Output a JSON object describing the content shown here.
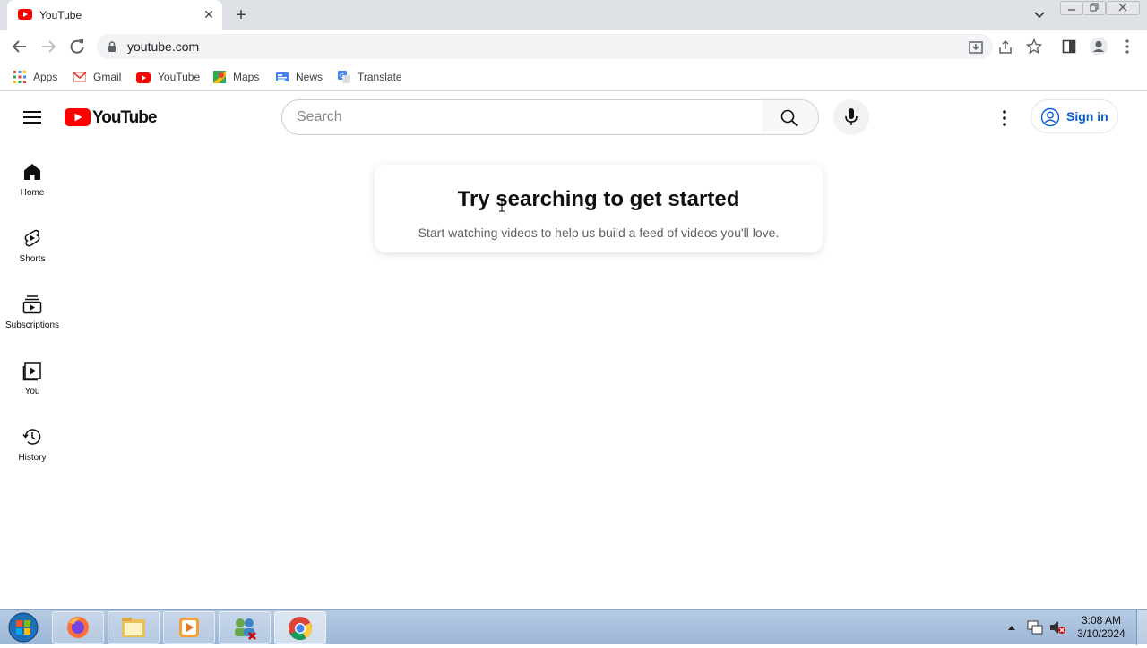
{
  "browser": {
    "tab_title": "YouTube",
    "new_tab_symbol": "+",
    "url": "youtube.com",
    "window_controls": [
      "minimize-icon",
      "restore-icon",
      "close-icon"
    ]
  },
  "bookmarks": [
    {
      "label": "Apps",
      "icon": "apps-grid-icon"
    },
    {
      "label": "Gmail",
      "icon": "gmail-icon"
    },
    {
      "label": "YouTube",
      "icon": "youtube-icon"
    },
    {
      "label": "Maps",
      "icon": "maps-icon"
    },
    {
      "label": "News",
      "icon": "news-icon"
    },
    {
      "label": "Translate",
      "icon": "translate-icon"
    }
  ],
  "youtube": {
    "logo_text": "YouTube",
    "search_placeholder": "Search",
    "sign_in_label": "Sign in",
    "brand_color": "#ff0000",
    "link_color": "#065fd4"
  },
  "sidebar": {
    "items": [
      {
        "label": "Home",
        "icon": "home-icon"
      },
      {
        "label": "Shorts",
        "icon": "shorts-icon"
      },
      {
        "label": "Subscriptions",
        "icon": "subscriptions-icon"
      },
      {
        "label": "You",
        "icon": "you-icon"
      },
      {
        "label": "History",
        "icon": "history-icon"
      }
    ]
  },
  "main": {
    "card_title": "Try searching to get started",
    "card_subtitle": "Start watching videos to help us build a feed of videos you'll love."
  },
  "taskbar": {
    "time": "3:08 AM",
    "date": "3/10/2024",
    "apps": [
      "start-orb-icon",
      "firefox-icon",
      "file-explorer-icon",
      "media-player-icon",
      "network-users-icon",
      "chrome-icon"
    ]
  }
}
